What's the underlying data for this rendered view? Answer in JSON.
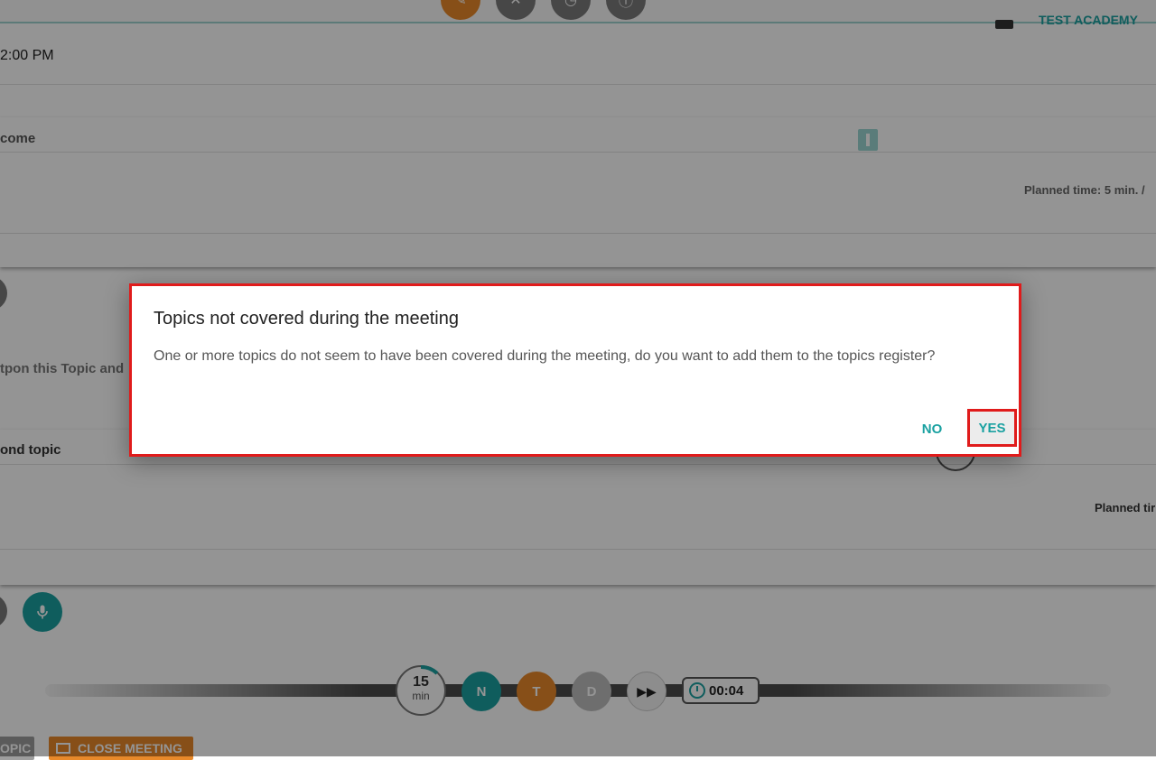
{
  "header": {
    "org_name": "TEST ACADEMY",
    "more_label": "···"
  },
  "meeting": {
    "time_fragment": "2:00 PM"
  },
  "topics": [
    {
      "title_fragment": "come",
      "planned_time": "Planned time: 5 min. /"
    },
    {
      "title_fragment": "ond topic",
      "planned_time": "Planned tir"
    }
  ],
  "postpone_fragment": "tpon this Topic and",
  "timeline": {
    "duration_value": "15",
    "duration_unit": "min",
    "btn_n": "N",
    "btn_t": "T",
    "btn_d": "D",
    "skip_glyph": "▶▶",
    "elapsed": "00:04"
  },
  "footer": {
    "topic_button_fragment": "OPIC",
    "close_meeting_label": "CLOSE MEETING"
  },
  "dialog": {
    "title": "Topics not covered during the meeting",
    "message": "One or more topics do not seem to have been covered during the meeting, do you want to add them to the topics register?",
    "no_label": "NO",
    "yes_label": "YES"
  }
}
